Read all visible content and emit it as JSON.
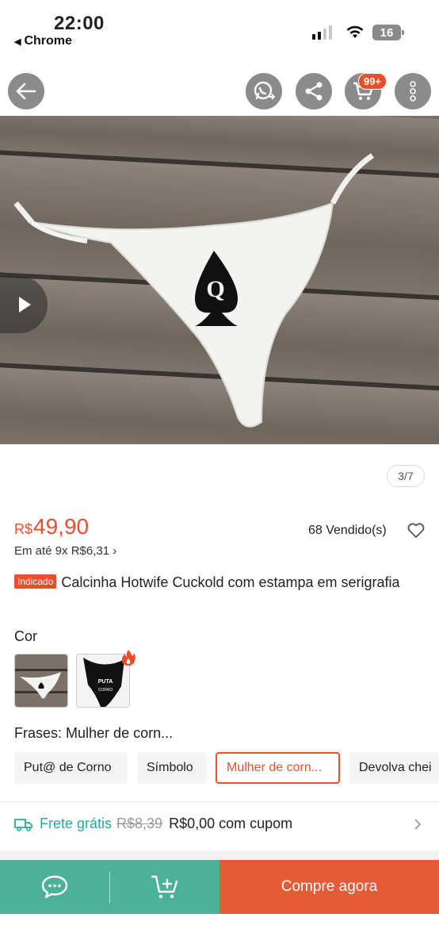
{
  "status_bar": {
    "time": "22:00",
    "back_app": "Chrome",
    "battery": "16"
  },
  "header": {
    "cart_badge": "99+",
    "icons": [
      "back-arrow-icon",
      "whatsapp-share-icon",
      "share-icon",
      "cart-icon",
      "more-icon"
    ]
  },
  "gallery": {
    "page_indicator": "3/7"
  },
  "product": {
    "currency": "R$",
    "price": "49,90",
    "installment": "Em até 9x R$6,31",
    "sold": "68 Vendido(s)",
    "tag": "Indicado",
    "title": "Calcinha Hotwife Cuckold com estampa em serigrafia"
  },
  "variations": {
    "color_label": "Cor",
    "phrases_label": "Frases:",
    "phrases_selected": "Mulher de corn...",
    "phrases": [
      "Put@ de Corno",
      "Símbolo",
      "Mulher de corn...",
      "Devolva chei"
    ]
  },
  "shipping": {
    "free": "Frete grátis",
    "old_price": "R$8,39",
    "new_price": "R$0,00 com cupom"
  },
  "bottom_bar": {
    "buy_label": "Compre agora"
  },
  "colors": {
    "accent": "#ee4d2d",
    "teal": "#4cb197",
    "buy": "#e55b35",
    "free_shipping": "#26aa99"
  }
}
